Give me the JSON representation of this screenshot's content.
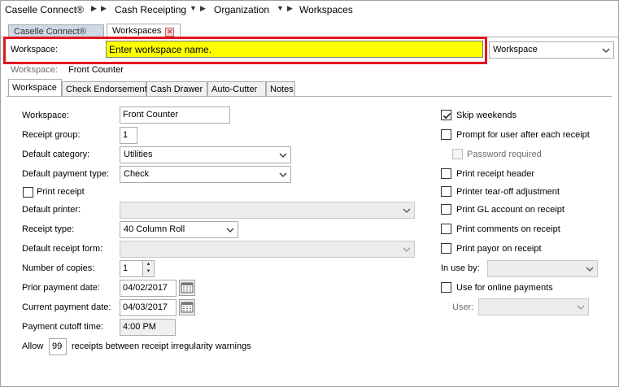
{
  "breadcrumb": {
    "items": [
      "Caselle Connect®",
      "Cash Receipting",
      "Organization",
      "Workspaces"
    ]
  },
  "doc_tabs": [
    {
      "label": "Caselle Connect®",
      "active": false
    },
    {
      "label": "Workspaces",
      "active": true
    }
  ],
  "search": {
    "label": "Workspace:",
    "value": "Enter workspace name.",
    "type_select": "Workspace"
  },
  "current": {
    "label": "Workspace:",
    "value": "Front Counter"
  },
  "tabs": [
    "Workspace",
    "Check Endorsement",
    "Cash Drawer",
    "Auto-Cutter",
    "Notes"
  ],
  "form": {
    "workspace_label": "Workspace:",
    "workspace_value": "Front Counter",
    "receipt_group_label": "Receipt group:",
    "receipt_group_value": "1",
    "default_category_label": "Default category:",
    "default_category_value": "Utilities",
    "default_payment_type_label": "Default payment type:",
    "default_payment_type_value": "Check",
    "print_receipt_label": "Print receipt",
    "default_printer_label": "Default printer:",
    "default_printer_value": "",
    "receipt_type_label": "Receipt type:",
    "receipt_type_value": "40 Column Roll",
    "default_receipt_form_label": "Default receipt form:",
    "default_receipt_form_value": "",
    "number_of_copies_label": "Number of copies:",
    "number_of_copies_value": "1",
    "prior_payment_date_label": "Prior payment date:",
    "prior_payment_date_value": "04/02/2017",
    "current_payment_date_label": "Current payment date:",
    "current_payment_date_value": "04/03/2017",
    "payment_cutoff_time_label": "Payment cutoff time:",
    "payment_cutoff_time_value": "4:00 PM",
    "allow_prefix": "Allow",
    "allow_value": "99",
    "allow_suffix": "receipts between receipt irregularity warnings"
  },
  "options": {
    "skip_weekends": "Skip weekends",
    "prompt_for_user": "Prompt for user after each receipt",
    "password_required": "Password required",
    "print_receipt_header": "Print receipt header",
    "printer_tear_off": "Printer tear-off adjustment",
    "print_gl_account": "Print GL account on receipt",
    "print_comments": "Print comments on receipt",
    "print_payor": "Print payor on receipt",
    "in_use_by_label": "In use by:",
    "in_use_by_value": "",
    "use_online_payments": "Use for online payments",
    "user_label": "User:",
    "user_value": ""
  },
  "checked": {
    "skip_weekends": true,
    "prompt_for_user": false,
    "password_required": false,
    "print_receipt": false,
    "print_receipt_header": false,
    "printer_tear_off": false,
    "print_gl_account": false,
    "print_comments": false,
    "print_payor": false,
    "use_online_payments": false
  },
  "colors": {
    "highlight_border": "#e0161e",
    "search_input_bg": "#ffff00",
    "inactive_tab_bg": "#cfd8e6"
  },
  "icons": [
    "chevron-right-icon",
    "chevron-down-icon",
    "close-icon",
    "calendar-icon",
    "checkmark-icon",
    "spin-up-icon",
    "spin-down-icon"
  ]
}
